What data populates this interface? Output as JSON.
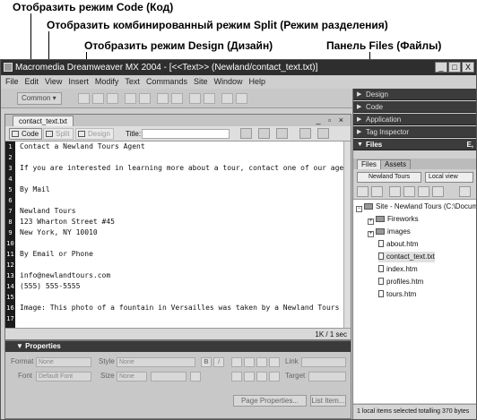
{
  "annotations": {
    "code_view": "Отобразить режим Code (Код)",
    "split_view": "Отобразить комбинированный режим Split (Режим разделения)",
    "design_view": "Отобразить режим Design (Дизайн)",
    "files_panel": "Панель Files (Файлы)"
  },
  "window": {
    "title": "Macromedia Dreamweaver MX 2004 - [<<Text>> (Newland/contact_text.txt)]",
    "minimize": "_",
    "restore": "□",
    "close": "X"
  },
  "menu": [
    "File",
    "Edit",
    "View",
    "Insert",
    "Modify",
    "Text",
    "Commands",
    "Site",
    "Window",
    "Help"
  ],
  "insert_bar": {
    "category": "Common ▾"
  },
  "document": {
    "tab": "contact_text.txt",
    "window_controls": "_ ▫ ×",
    "code_button": "Code",
    "split_button": "Split",
    "design_button": "Design",
    "title_label": "Title:",
    "status": "1K / 1 sec",
    "lines": [
      {
        "n": "1",
        "text": "Contact a Newland Tours Agent"
      },
      {
        "n": "2",
        "text": ""
      },
      {
        "n": "3",
        "text": "If you are interested in learning more about a tour, contact one of our age"
      },
      {
        "n": "4",
        "text": ""
      },
      {
        "n": "5",
        "text": "By Mail"
      },
      {
        "n": "6",
        "text": ""
      },
      {
        "n": "7",
        "text": "Newland Tours"
      },
      {
        "n": "8",
        "text": "123 Wharton Street #45"
      },
      {
        "n": "9",
        "text": "New York, NY 10010"
      },
      {
        "n": "10",
        "text": ""
      },
      {
        "n": "11",
        "text": "By Email or Phone"
      },
      {
        "n": "12",
        "text": ""
      },
      {
        "n": "13",
        "text": "info@newlandtours.com"
      },
      {
        "n": "14",
        "text": "(555)    555-5555"
      },
      {
        "n": "15",
        "text": ""
      },
      {
        "n": "16",
        "text": "Image: This photo of a fountain in Versailles was taken by a Newland Tours"
      },
      {
        "n": "17",
        "text": ""
      }
    ]
  },
  "properties": {
    "header": "▼ Properties",
    "format_label": "Format",
    "format_value": "None",
    "style_label": "Style",
    "style_value": "None",
    "bold": "B",
    "italic": "I",
    "link_label": "Link",
    "font_label": "Font",
    "font_value": "Default Font",
    "size_label": "Size",
    "size_value": "None",
    "target_label": "Target",
    "page_properties": "Page Properties...",
    "list_item": "List Item..."
  },
  "panels": {
    "design": "Design",
    "code": "Code",
    "application": "Application",
    "tag_inspector": "Tag Inspector",
    "files": "Files",
    "files_menu": "E,",
    "tab_files": "Files",
    "tab_assets": "Assets",
    "site_select": "Newland Tours",
    "view_select": "Local view",
    "tree": [
      {
        "label": "Site - Newland Tours (C:\\Documen",
        "type": "site",
        "indent": 0
      },
      {
        "label": "Fireworks",
        "type": "folder",
        "indent": 1
      },
      {
        "label": "images",
        "type": "folder",
        "indent": 1
      },
      {
        "label": "about.htm",
        "type": "file",
        "indent": 2
      },
      {
        "label": "contact_text.txt",
        "type": "file",
        "indent": 2
      },
      {
        "label": "index.htm",
        "type": "file",
        "indent": 2
      },
      {
        "label": "profiles.htm",
        "type": "file",
        "indent": 2
      },
      {
        "label": "tours.htm",
        "type": "file",
        "indent": 2
      }
    ],
    "status": "1 local items selected totalling 370 bytes"
  }
}
